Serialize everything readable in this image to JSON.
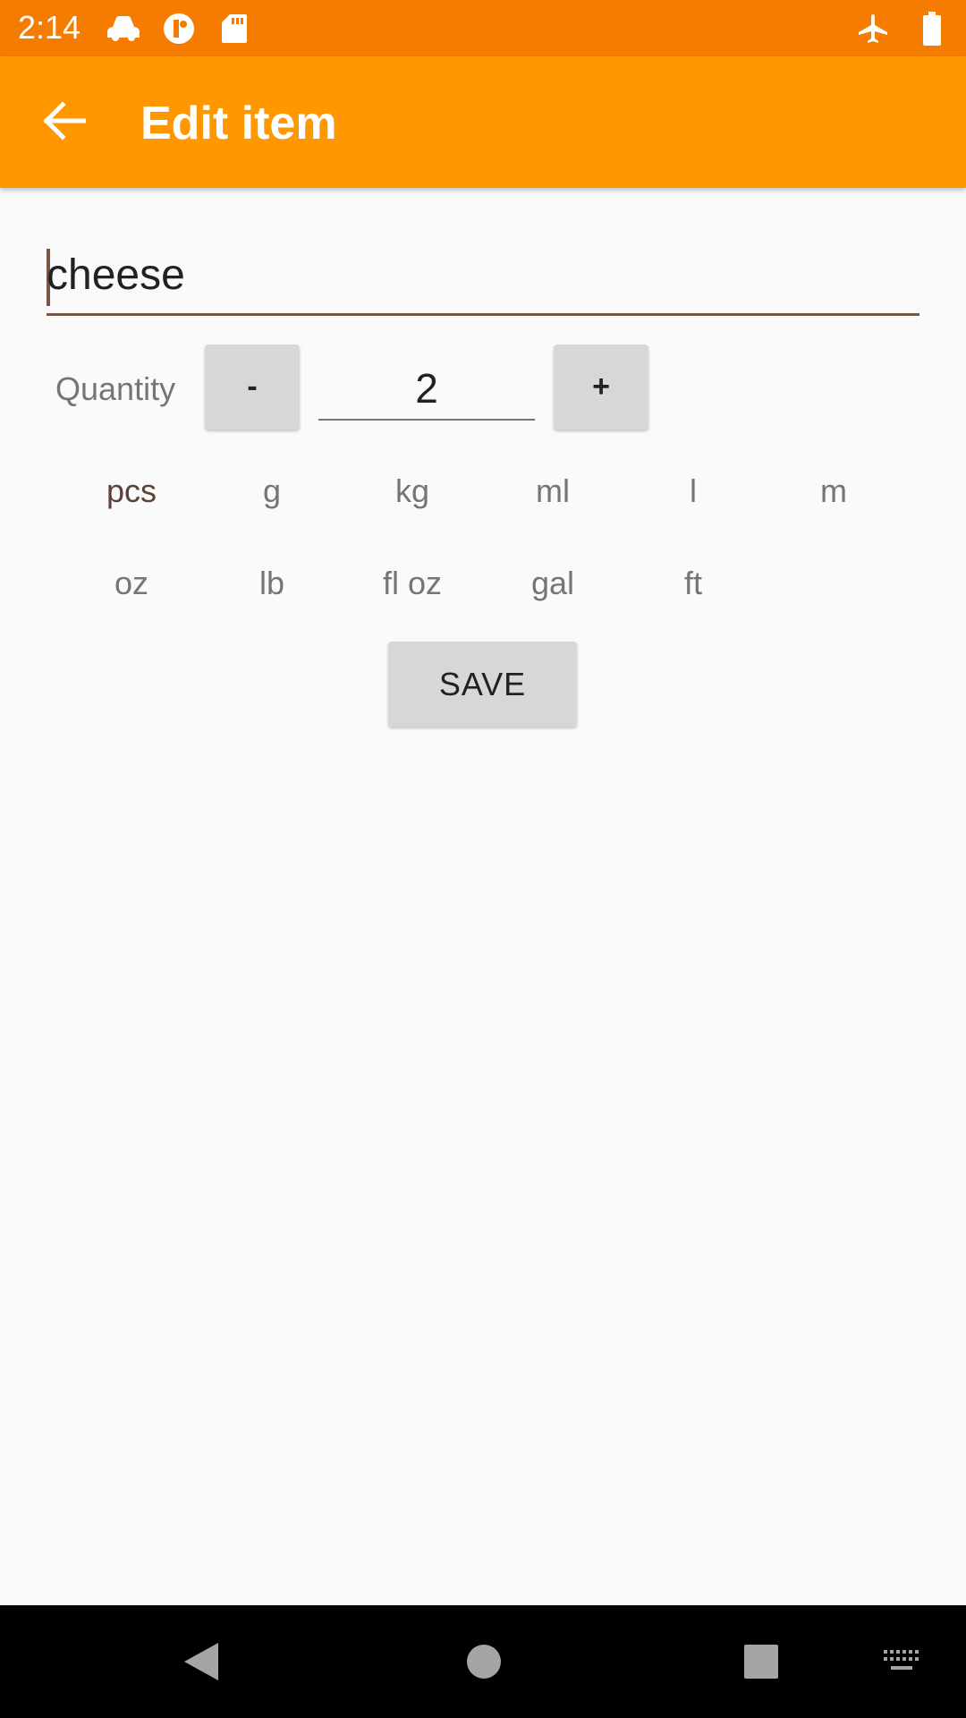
{
  "status_bar": {
    "time": "2:14",
    "left_icons": [
      "car-icon",
      "account-icon",
      "sd-card-icon"
    ],
    "right_icons": [
      "airplane-icon",
      "battery-icon"
    ],
    "color": "#f57c00"
  },
  "app_bar": {
    "back_icon": "arrow-back-icon",
    "title": "Edit item",
    "color": "#ff9800"
  },
  "form": {
    "name_value": "cheese",
    "quantity_label": "Quantity",
    "minus_label": "-",
    "quantity_value": "2",
    "plus_label": "+",
    "units_row1": [
      "pcs",
      "g",
      "kg",
      "ml",
      "l",
      "m"
    ],
    "units_row2": [
      "oz",
      "lb",
      "fl oz",
      "gal",
      "ft"
    ],
    "selected_unit": "pcs",
    "save_label": "SAVE"
  },
  "nav_bar": {
    "icons": [
      "back-triangle-icon",
      "home-circle-icon",
      "recents-square-icon",
      "keyboard-icon"
    ]
  }
}
